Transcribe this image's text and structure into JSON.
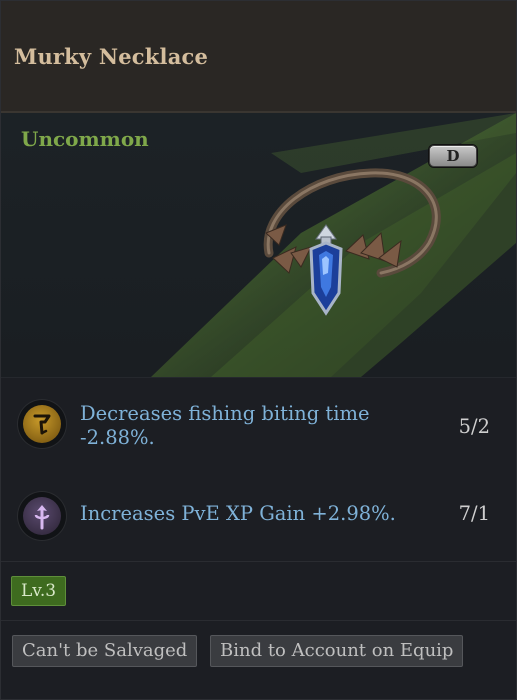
{
  "item": {
    "name": "Murky Necklace",
    "rarity": "Uncommon",
    "grade": "D",
    "rarity_color": "#7fa84a",
    "icon": "necklace-icon"
  },
  "stats": [
    {
      "icon": "fishing-icon",
      "text": "Decreases fishing biting time -2.88%.",
      "rank": "5/2"
    },
    {
      "icon": "xp-staff-icon",
      "text": "Increases PvE XP Gain +2.98%.",
      "rank": "7/1"
    }
  ],
  "level": "Lv.3",
  "tags": [
    "Can't be Salvaged",
    "Bind to Account on Equip"
  ],
  "colors": {
    "title": "#d4bd9d",
    "stat_text": "#7fb2d8",
    "level_bg": "#3e6b1f"
  }
}
